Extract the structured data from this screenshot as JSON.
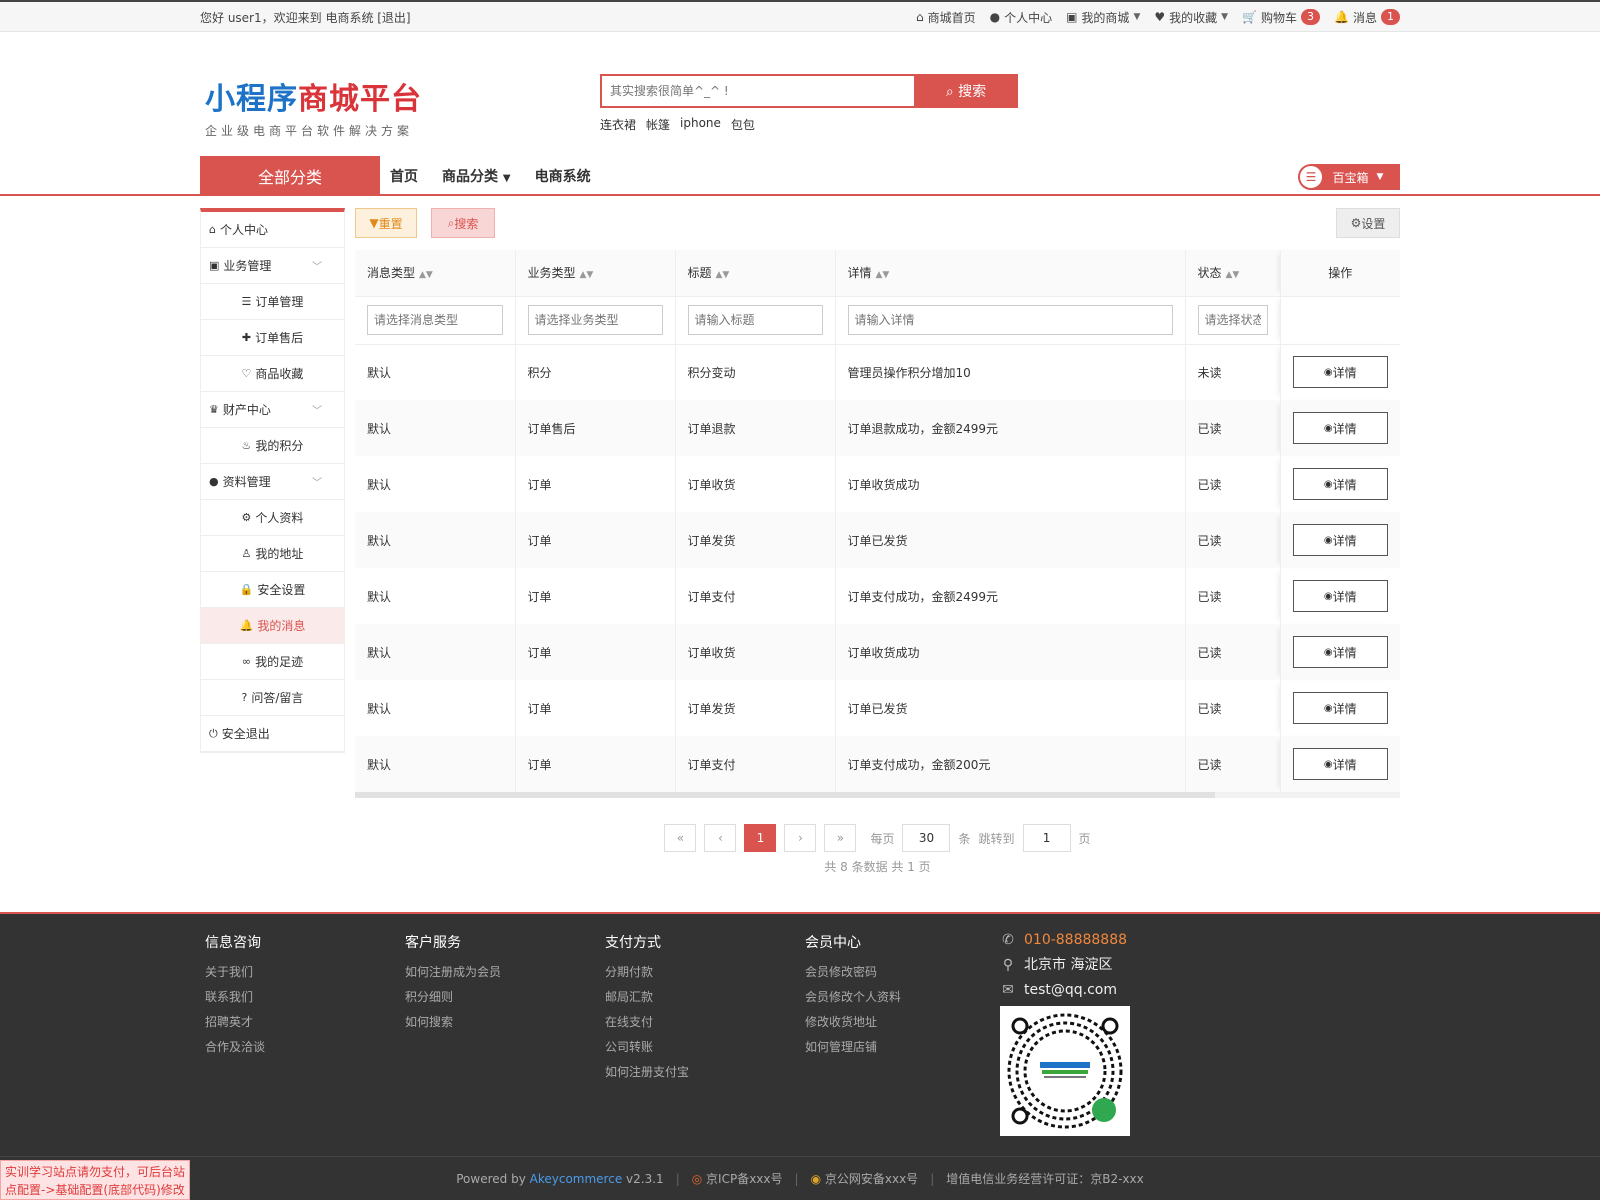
{
  "topbar": {
    "welcome": "您好 user1，欢迎来到 电商系统 [退出]",
    "links": [
      {
        "icon": "home-icon",
        "label": "商城首页"
      },
      {
        "icon": "user-icon",
        "label": "个人中心"
      },
      {
        "icon": "cube-icon",
        "label": "我的商城",
        "dropdown": true
      },
      {
        "icon": "heart-icon",
        "label": "我的收藏",
        "dropdown": true
      },
      {
        "icon": "cart-icon",
        "label": "购物车",
        "badge": "3"
      },
      {
        "icon": "bell-icon",
        "label": "消息",
        "badge": "1"
      }
    ]
  },
  "logo": {
    "part1": "小程序",
    "part2": "商城平台",
    "slogan": "企业级电商平台软件解决方案"
  },
  "search": {
    "placeholder": "其实搜索很简单^_^ !",
    "button": "搜索",
    "hot": [
      "连衣裙",
      "帐篷",
      "iphone",
      "包包"
    ]
  },
  "nav": {
    "all_category": "全部分类",
    "links": [
      "首页",
      "商品分类",
      "电商系统"
    ],
    "treasure": "百宝箱"
  },
  "sidebar": {
    "items": [
      {
        "label": "个人中心",
        "icon": "home-icon",
        "level": 1
      },
      {
        "label": "业务管理",
        "icon": "cube-icon",
        "level": 1,
        "expand": true
      },
      {
        "label": "订单管理",
        "icon": "list-icon",
        "level": 2
      },
      {
        "label": "订单售后",
        "icon": "puzzle-icon",
        "level": 2
      },
      {
        "label": "商品收藏",
        "icon": "heart-outline-icon",
        "level": 2
      },
      {
        "label": "财产中心",
        "icon": "trophy-icon",
        "level": 1,
        "expand": true
      },
      {
        "label": "我的积分",
        "icon": "fire-icon",
        "level": 2
      },
      {
        "label": "资料管理",
        "icon": "user-icon",
        "level": 1,
        "expand": true
      },
      {
        "label": "个人资料",
        "icon": "gear-icon",
        "level": 2
      },
      {
        "label": "我的地址",
        "icon": "pin-icon",
        "level": 2
      },
      {
        "label": "安全设置",
        "icon": "lock-icon",
        "level": 2
      },
      {
        "label": "我的消息",
        "icon": "bell-outline-icon",
        "level": 2,
        "active": true
      },
      {
        "label": "我的足迹",
        "icon": "footprint-icon",
        "level": 2
      },
      {
        "label": "问答/留言",
        "icon": "question-icon",
        "level": 2
      },
      {
        "label": "安全退出",
        "icon": "power-icon",
        "level": 1
      }
    ]
  },
  "toolbar": {
    "reset": "重置",
    "search": "搜索",
    "settings": "设置"
  },
  "table": {
    "columns": [
      "消息类型",
      "业务类型",
      "标题",
      "详情",
      "状态",
      "操作"
    ],
    "filters": [
      "请选择消息类型",
      "请选择业务类型",
      "请输入标题",
      "请输入详情",
      "请选择状态"
    ],
    "detail_button": "详情",
    "rows": [
      [
        "默认",
        "积分",
        "积分变动",
        "管理员操作积分增加10",
        "未读"
      ],
      [
        "默认",
        "订单售后",
        "订单退款",
        "订单退款成功，金额2499元",
        "已读"
      ],
      [
        "默认",
        "订单",
        "订单收货",
        "订单收货成功",
        "已读"
      ],
      [
        "默认",
        "订单",
        "订单发货",
        "订单已发货",
        "已读"
      ],
      [
        "默认",
        "订单",
        "订单支付",
        "订单支付成功，金额2499元",
        "已读"
      ],
      [
        "默认",
        "订单",
        "订单收货",
        "订单收货成功",
        "已读"
      ],
      [
        "默认",
        "订单",
        "订单发货",
        "订单已发货",
        "已读"
      ],
      [
        "默认",
        "订单",
        "订单支付",
        "订单支付成功，金额200元",
        "已读"
      ]
    ]
  },
  "pager": {
    "first": "«",
    "prev": "‹",
    "current": "1",
    "next": "›",
    "last": "»",
    "per_page_label": "每页",
    "per_page": "30",
    "per_page_unit": "条",
    "jump_label": "跳转到",
    "jump_value": "1",
    "jump_unit": "页",
    "summary": "共 8 条数据   共 1 页"
  },
  "footer": {
    "columns": [
      {
        "title": "信息咨询",
        "links": [
          "关于我们",
          "联系我们",
          "招聘英才",
          "合作及洽谈"
        ]
      },
      {
        "title": "客户服务",
        "links": [
          "如何注册成为会员",
          "积分细则",
          "如何搜索"
        ]
      },
      {
        "title": "支付方式",
        "links": [
          "分期付款",
          "邮局汇款",
          "在线支付",
          "公司转账",
          "如何注册支付宝"
        ]
      },
      {
        "title": "会员中心",
        "links": [
          "会员修改密码",
          "会员修改个人资料",
          "修改收货地址",
          "如何管理店铺"
        ]
      }
    ],
    "phone": "010-88888888",
    "address": "北京市 海淀区",
    "email": "test@qq.com",
    "powered_prefix": "Powered by",
    "powered_brand": "Akeycommerce",
    "version": "v2.3.1",
    "icp": "京ICP备xxx号",
    "police": "京公网安备xxx号",
    "license": "增值电信业务经营许可证：京B2-xxx",
    "notice": "实训学习站点请勿支付，可后台站点配置->基础配置(底部代码)修改"
  },
  "colors": {
    "accent": "#d9534f",
    "logo_blue": "#1e73c6",
    "footer_bg": "#333333"
  }
}
